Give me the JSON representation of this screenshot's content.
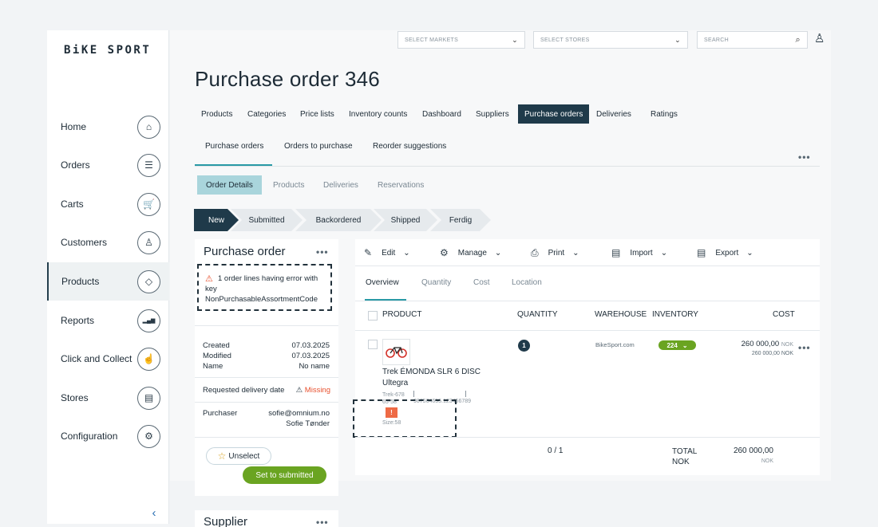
{
  "brand": "BiKE SPORT",
  "sidebar": {
    "items": [
      {
        "label": "Home",
        "icon": "home-icon",
        "glyph": "⌂"
      },
      {
        "label": "Orders",
        "icon": "list-icon",
        "glyph": "☰"
      },
      {
        "label": "Carts",
        "icon": "cart-icon",
        "glyph": "🛒"
      },
      {
        "label": "Customers",
        "icon": "user-icon",
        "glyph": "♙"
      },
      {
        "label": "Products",
        "icon": "tag-icon",
        "glyph": "◇"
      },
      {
        "label": "Reports",
        "icon": "bar-chart-icon",
        "glyph": "▂▄▆"
      },
      {
        "label": "Click and Collect",
        "icon": "hand-pointer-icon",
        "glyph": "☝"
      },
      {
        "label": "Stores",
        "icon": "store-icon",
        "glyph": "▤"
      },
      {
        "label": "Configuration",
        "icon": "gear-icon",
        "glyph": "⚙"
      }
    ],
    "active": "Products",
    "collapse_glyph": "‹"
  },
  "topbar": {
    "markets_placeholder": "SELECT MARKETS",
    "stores_placeholder": "SELECT STORES",
    "search_placeholder": "SEARCH"
  },
  "page_title": "Purchase order 346",
  "main_tabs": [
    "Products",
    "Categories",
    "Price lists",
    "Inventory counts",
    "Dashboard",
    "Suppliers",
    "Purchase orders",
    "Deliveries",
    "Ratings"
  ],
  "main_tabs_active": "Purchase orders",
  "sub_tabs": [
    "Purchase orders",
    "Orders to purchase",
    "Reorder suggestions"
  ],
  "detail_tabs": [
    "Order Details",
    "Products",
    "Deliveries",
    "Reservations"
  ],
  "steps": [
    "New",
    "Submitted",
    "Backordered",
    "Shipped",
    "Ferdig"
  ],
  "left_card": {
    "title": "Purchase order",
    "error_msg": "1 order lines having error with key NonPurchasableAssortmentCode",
    "created_label": "Created",
    "created": "07.03.2025",
    "modified_label": "Modified",
    "modified": "07.03.2025",
    "name_label": "Name",
    "name": "No name",
    "req_delivery_label": "Requested delivery date",
    "req_delivery": "Missing",
    "purchaser_label": "Purchaser",
    "purchaser_email": "sofie@omnium.no",
    "purchaser_name": "Sofie Tønder",
    "unselect": "Unselect",
    "submit": "Set to submitted",
    "supplier_title": "Supplier"
  },
  "toolbar": [
    "Edit",
    "Manage",
    "Print",
    "Import",
    "Export"
  ],
  "order_tabs": [
    "Overview",
    "Quantity",
    "Cost",
    "Location"
  ],
  "table": {
    "headers": [
      "PRODUCT",
      "QUANTITY",
      "WAREHOUSE",
      "INVENTORY",
      "COST"
    ],
    "row": {
      "name": "Trek ÉMONDA SLR 6 DISC Ultegra",
      "sku": "Trek-67865-58",
      "barcode": "987564655.123456789",
      "size": "Size:58",
      "quantity": "1",
      "warehouse": "BikeSport.com",
      "inventory": "224",
      "cost": "260 000,00",
      "cost_currency": "NOK",
      "cost_sub": "260 000,00 NOK",
      "error_badge": "!"
    },
    "footer": {
      "qty": "0 / 1",
      "total_label": "TOTAL NOK",
      "total": "260 000,00",
      "total_currency": "NOK"
    }
  },
  "colors": {
    "primary_dark": "#1f3a4a",
    "accent_teal": "#a9d5dc",
    "green": "#6aa421",
    "error": "#e8512f"
  }
}
